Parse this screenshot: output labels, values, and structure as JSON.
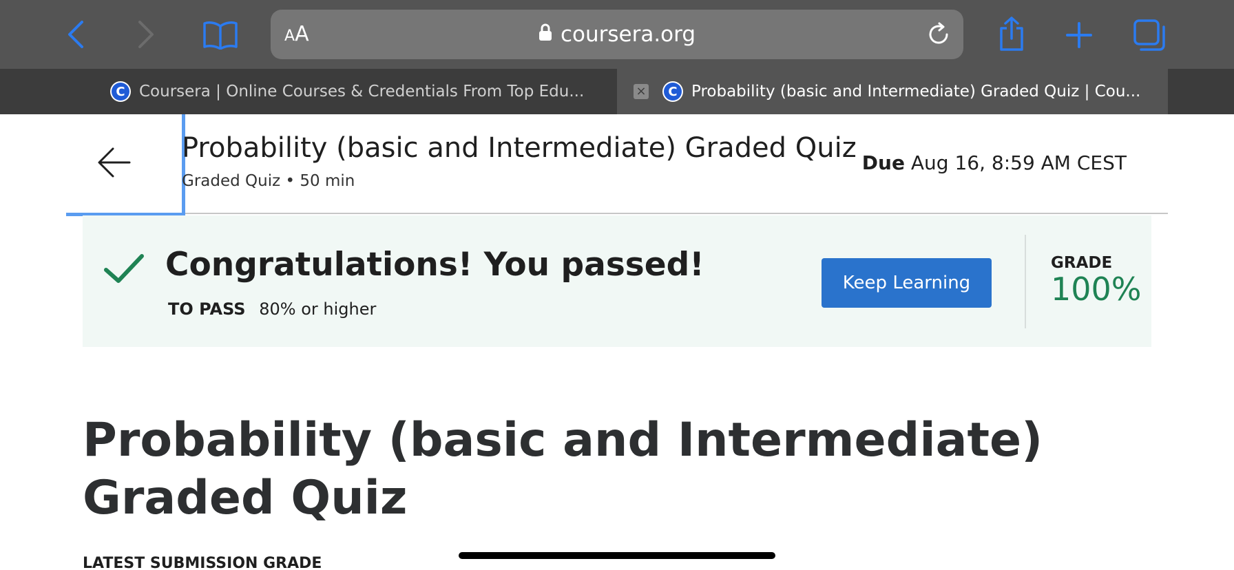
{
  "browser": {
    "address": {
      "aa_small": "A",
      "aa_big": "A",
      "domain": "coursera.org"
    },
    "tabs": [
      {
        "title": "Coursera | Online Courses & Credentials From Top Edu...",
        "favicon": "coursera-icon",
        "active": false
      },
      {
        "title": "Probability (basic and Intermediate) Graded Quiz | Cou...",
        "favicon": "coursera-icon",
        "active": true
      }
    ],
    "colors": {
      "toolbar": "#545454",
      "tab_strip": "#3c3c3c",
      "accent": "#2b7bf0"
    },
    "icons": [
      "chevron-left-icon",
      "chevron-right-icon",
      "book-icon",
      "lock-icon",
      "reload-icon",
      "share-icon",
      "plus-icon",
      "tabs-icon"
    ]
  },
  "header": {
    "title": "Probability (basic and Intermediate) Graded Quiz",
    "subtitle": "Graded Quiz • 50 min",
    "due_label": "Due",
    "due_value": "Aug 16, 8:59 AM CEST"
  },
  "result": {
    "message": "Congratulations! You passed!",
    "to_pass_label": "TO PASS",
    "to_pass_value": "80% or higher",
    "button_label": "Keep Learning",
    "grade_label": "GRADE",
    "grade_value": "100%",
    "colors": {
      "panel": "#f1f8f5",
      "success": "#1f8354",
      "button": "#2a73cc"
    }
  },
  "main": {
    "title": "Probability (basic and Intermediate) Graded Quiz",
    "latest_label": "LATEST SUBMISSION GRADE"
  }
}
